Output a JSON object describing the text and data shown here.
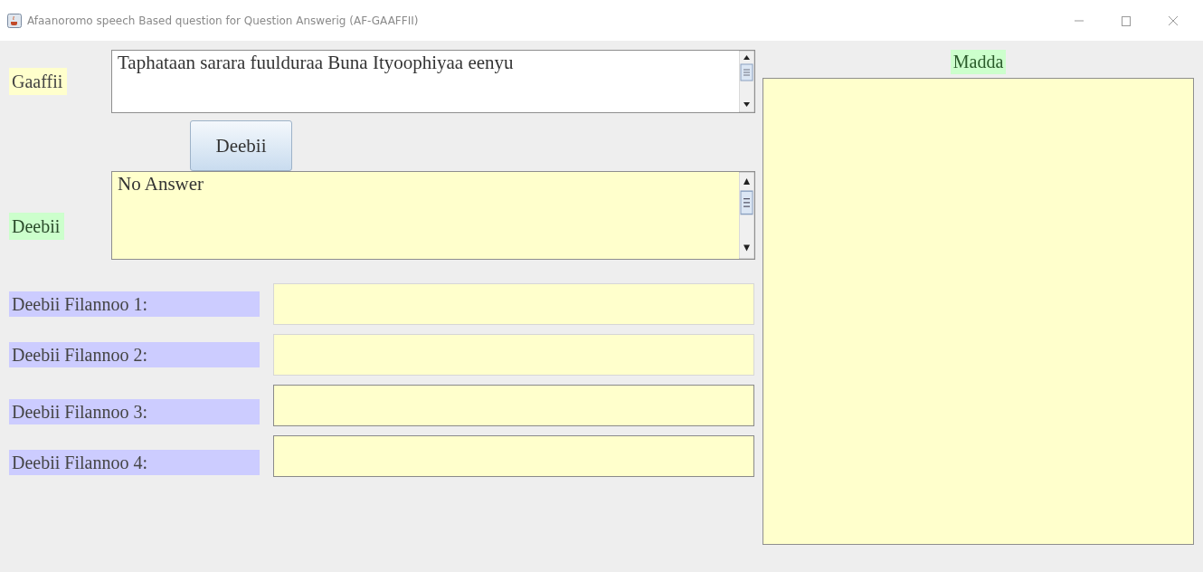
{
  "window": {
    "title": "Afaanoromo speech Based question for  Question Answerig (AF-GAAFFII)"
  },
  "question": {
    "label": "Gaaffii",
    "value": "Taphataan sarara fuulduraa Buna Ityoophiyaa eenyu"
  },
  "answer_button": "Deebii",
  "answer": {
    "label": "Deebii",
    "value": "No Answer"
  },
  "choices": [
    {
      "label": "Deebii Filannoo 1:"
    },
    {
      "label": "Deebii Filannoo 2:"
    },
    {
      "label": "Deebii Filannoo 3:"
    },
    {
      "label": "Deebii Filannoo 4:"
    }
  ],
  "source": {
    "label": "Madda"
  }
}
